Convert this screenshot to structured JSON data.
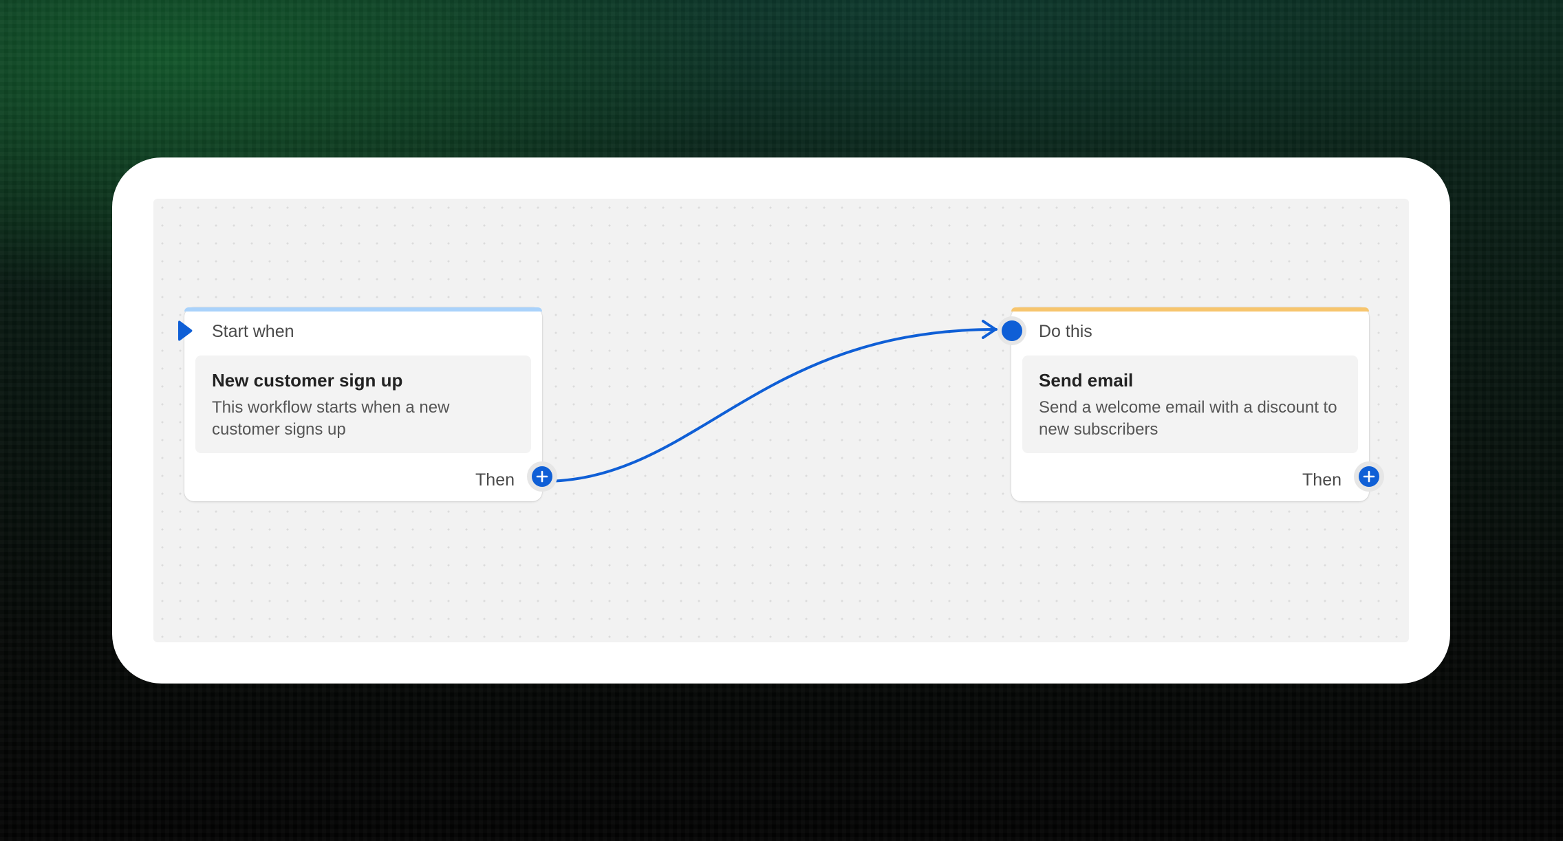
{
  "theme": {
    "accent_blue": "#0f5fd6",
    "trigger_accent": "#a9d2fb",
    "action_accent": "#f7c56d"
  },
  "workflow": {
    "trigger": {
      "header": "Start when",
      "title": "New customer sign up",
      "description": "This workflow starts when a new customer signs up",
      "footer": "Then",
      "marker_icon": "play-marker-icon",
      "add_icon": "plus-icon"
    },
    "action": {
      "header": "Do this",
      "title": "Send email",
      "description": "Send a welcome email with a discount to new subscribers",
      "footer": "Then",
      "input_icon": "connection-dot-icon",
      "add_icon": "plus-icon"
    }
  }
}
